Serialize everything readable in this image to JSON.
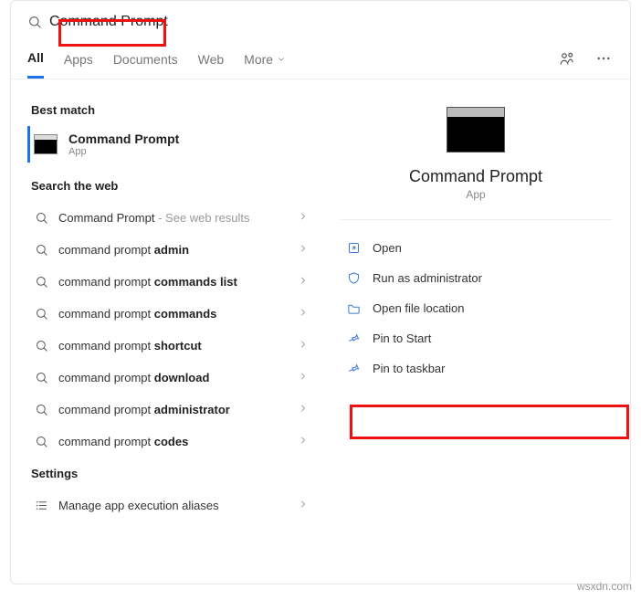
{
  "search": {
    "query": "Command Prompt"
  },
  "tabs": {
    "all": "All",
    "apps": "Apps",
    "documents": "Documents",
    "web": "Web",
    "more": "More"
  },
  "sections": {
    "best_match": "Best match",
    "search_web": "Search the web",
    "settings": "Settings"
  },
  "best_match": {
    "title": "Command Prompt",
    "subtitle": "App"
  },
  "web_results": [
    {
      "prefix": "Command Prompt",
      "bold": "",
      "suffix": " - See web results"
    },
    {
      "prefix": "command prompt ",
      "bold": "admin",
      "suffix": ""
    },
    {
      "prefix": "command prompt ",
      "bold": "commands list",
      "suffix": ""
    },
    {
      "prefix": "command prompt ",
      "bold": "commands",
      "suffix": ""
    },
    {
      "prefix": "command prompt ",
      "bold": "shortcut",
      "suffix": ""
    },
    {
      "prefix": "command prompt ",
      "bold": "download",
      "suffix": ""
    },
    {
      "prefix": "command prompt ",
      "bold": "administrator",
      "suffix": ""
    },
    {
      "prefix": "command prompt ",
      "bold": "codes",
      "suffix": ""
    }
  ],
  "settings_items": [
    {
      "label": "Manage app execution aliases"
    }
  ],
  "preview": {
    "title": "Command Prompt",
    "subtitle": "App"
  },
  "actions": [
    {
      "icon": "open",
      "label": "Open"
    },
    {
      "icon": "shield",
      "label": "Run as administrator"
    },
    {
      "icon": "folder",
      "label": "Open file location"
    },
    {
      "icon": "pin",
      "label": "Pin to Start"
    },
    {
      "icon": "pin",
      "label": "Pin to taskbar"
    }
  ],
  "watermark": "wsxdn.com"
}
